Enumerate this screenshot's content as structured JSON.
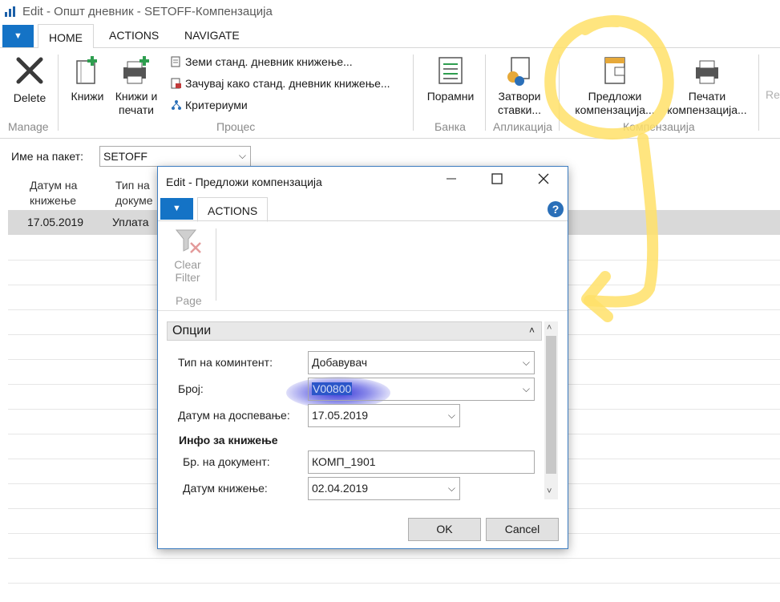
{
  "window": {
    "title": "Edit - Општ дневник - SETOFF-Компензација"
  },
  "ribbon": {
    "tabs": [
      "HOME",
      "ACTIONS",
      "NAVIGATE"
    ],
    "buttons": {
      "delete": "Delete",
      "post": "Книжи",
      "post_print": [
        "Книжи и",
        "печати"
      ],
      "get_std": "Земи станд. дневник книжење...",
      "save_std": "Зачувај како станд. дневник книжење...",
      "criteria": "Критериуми",
      "reconcile": "Порамни",
      "close_entries": [
        "Затвори",
        "ставки..."
      ],
      "suggest_comp": [
        "Предложи",
        "компензација..."
      ],
      "print_comp": [
        "Печати",
        "компензација..."
      ],
      "cut_off": "Re"
    },
    "groups": {
      "manage": "Manage",
      "process": "Процес",
      "bank": "Банка",
      "application": "Апликација",
      "compensation": "Компензација"
    }
  },
  "batch": {
    "label": "Име на пакет:",
    "value": "SETOFF"
  },
  "grid": {
    "headers": [
      [
        "Датум на",
        "книжење"
      ],
      [
        "Тип на",
        "докуме"
      ]
    ],
    "rows": [
      [
        "17.05.2019",
        "Уплата"
      ]
    ]
  },
  "dialog": {
    "title": "Edit - Предложи компензација",
    "tab": "ACTIONS",
    "clear_filter": [
      "Clear",
      "Filter"
    ],
    "page_group": "Page",
    "fasttab": "Опции",
    "fields": {
      "client_type_label": "Тип на коминтент:",
      "client_type_value": "Добавувач",
      "number_label": "Број:",
      "number_value": "V00800",
      "due_date_label": "Датум на доспевање:",
      "due_date_value": "17.05.2019",
      "posting_info_head": "Инфо за книжење",
      "doc_no_label": "Бр. на документ:",
      "doc_no_value": "КОМП_1901",
      "posting_date_label": "Датум книжење:",
      "posting_date_value": "02.04.2019"
    },
    "ok": "OK",
    "cancel": "Cancel"
  },
  "colors": {
    "accent": "#1473c6",
    "annotation": "#ffe169",
    "selection": "#2b56c9"
  }
}
